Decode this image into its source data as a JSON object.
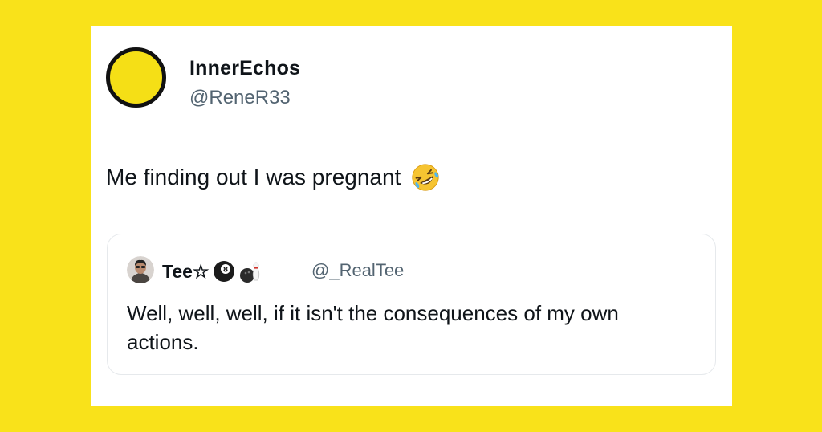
{
  "tweet": {
    "author_name": "InnerEchos",
    "author_handle": "@ReneR33",
    "text": "Me finding out I was pregnant",
    "emoji": "rolling-on-floor-laughing-emoji"
  },
  "quoted_tweet": {
    "author_name": "Tee☆",
    "badges": [
      "8-ball-icon",
      "bowling-icon"
    ],
    "author_handle": "@_RealTee",
    "text": "Well, well, well, if it isn't the consequences of my own actions."
  },
  "colors": {
    "background": "#f9e21a",
    "card": "#ffffff",
    "avatar_fill": "#f5df16",
    "text": "#0f1419",
    "muted": "#536471",
    "quote_border": "#e6e9ec"
  }
}
